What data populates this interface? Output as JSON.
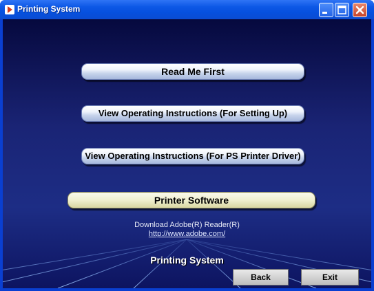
{
  "window": {
    "title": "Printing System",
    "colors": {
      "titlebar": "#0a4cd2",
      "background": "#1d2d85"
    }
  },
  "menu": {
    "read_me_first": "Read Me First",
    "setup_instructions": "View Operating Instructions (For Setting Up)",
    "ps_driver_instructions": "View Operating Instructions (For PS Printer Driver)",
    "printer_software": "Printer Software"
  },
  "download": {
    "label": "Download Adobe(R) Reader(R)",
    "link": "http://www.adobe.com/"
  },
  "footer": {
    "title": "Printing System",
    "back_label": "Back",
    "exit_label": "Exit"
  },
  "icons": [
    "app-arrow-icon",
    "minimize-icon",
    "maximize-icon",
    "close-icon"
  ]
}
